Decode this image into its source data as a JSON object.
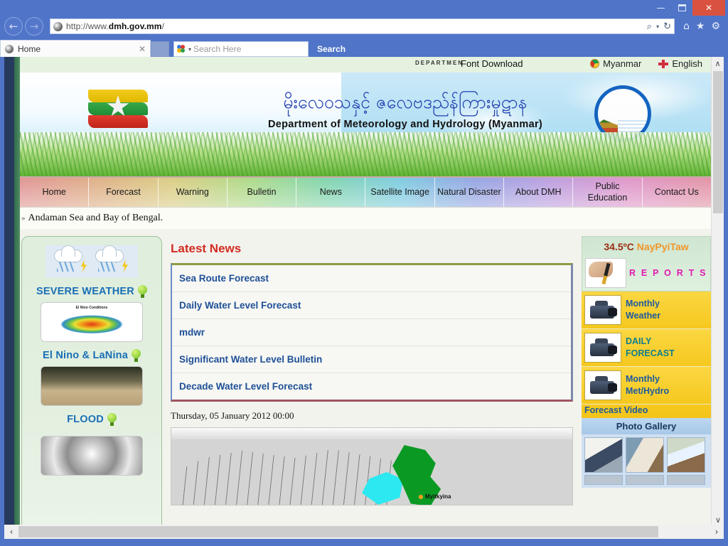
{
  "browser": {
    "window_controls": {
      "minimize": "–",
      "maximize": "□",
      "close": "✕"
    },
    "back_icon": "←",
    "forward_icon": "→",
    "url_prefix": "http://www.",
    "url_domain": "dmh.gov.mm",
    "url_suffix": "/",
    "search_glyph": "⌕",
    "search_caret": "▾",
    "refresh_glyph": "↻",
    "home_icon": "⌂",
    "favorites_icon": "★",
    "settings_icon": "⚙",
    "tab_title": "Home",
    "tab_close": "✕",
    "search_placeholder": "Search Here",
    "search_button": "Search",
    "hscroll_left": "‹",
    "hscroll_right": "›",
    "vscroll_up": "∧",
    "vscroll_down": "∨"
  },
  "utilbar": {
    "watermark": "DEPARTMEN",
    "font_download": "Font Download",
    "languages": [
      {
        "label": "Myanmar",
        "flag": "flag-myanmar"
      },
      {
        "label": "English",
        "flag": "flag-uk"
      }
    ]
  },
  "banner": {
    "title_mm": "မိုးလေဝသနှင့် ဇလေဗဒည်န်ကြားမှုဋာန",
    "title_en": "Department of Meteorology and Hydrology (Myanmar)"
  },
  "nav": [
    {
      "label": "Home"
    },
    {
      "label": "Forecast"
    },
    {
      "label": "Warning"
    },
    {
      "label": "Bulletin"
    },
    {
      "label": "News"
    },
    {
      "label": "Satellite Image"
    },
    {
      "label": "Natural Disaster"
    },
    {
      "label": "About DMH"
    },
    {
      "label": "Public Education"
    },
    {
      "label": "Contact Us"
    }
  ],
  "ticker": {
    "bullet": "»",
    "text": "Andaman Sea and Bay of Bengal."
  },
  "sidebar_left": {
    "items": [
      {
        "label": "SEVERE WEATHER",
        "icon": "bulb-icon",
        "thumb": "storm-clouds-icon"
      },
      {
        "label": "El Nino & LaNina",
        "icon": "bulb-icon",
        "thumb": "elnino-chart-thumb"
      },
      {
        "label": "FLOOD",
        "icon": "bulb-icon",
        "thumb": "flood-photo-thumb"
      }
    ],
    "cyclone_thumb": "cyclone-satellite-thumb"
  },
  "main": {
    "heading": "Latest News",
    "news": [
      {
        "label": "Sea Route Forecast"
      },
      {
        "label": "Daily Water Level Forecast"
      },
      {
        "label": "mdwr"
      },
      {
        "label": "Significant Water Level Bulletin"
      },
      {
        "label": "Decade Water Level Forecast"
      }
    ],
    "date": "Thursday, 05 January 2012 00:00",
    "map_pin_label": "Myitkyina"
  },
  "sidebar_right": {
    "temperature": "34.5ºC",
    "city": "NayPyiTaw",
    "reports_label": "R E P O R T S",
    "reports": [
      {
        "line1": "Monthly",
        "line2": "Weather",
        "style": "blue"
      },
      {
        "line1": "DAILY",
        "line2": "FORECAST",
        "style": "teal"
      },
      {
        "line1": "Monthly",
        "line2": "Met/Hydro",
        "sub": "Forecast Video",
        "style": "blue"
      }
    ],
    "gallery_title": "Photo Gallery",
    "gallery_next": "›"
  },
  "colors": {
    "accent_red": "#d22b20",
    "link_blue": "#1e5096",
    "temp_red": "#9b2f12",
    "temp_orange": "#f0962a",
    "reports_pink": "#e01ab0",
    "chrome_blue": "#4f74c8",
    "close_red": "#d9523f"
  }
}
